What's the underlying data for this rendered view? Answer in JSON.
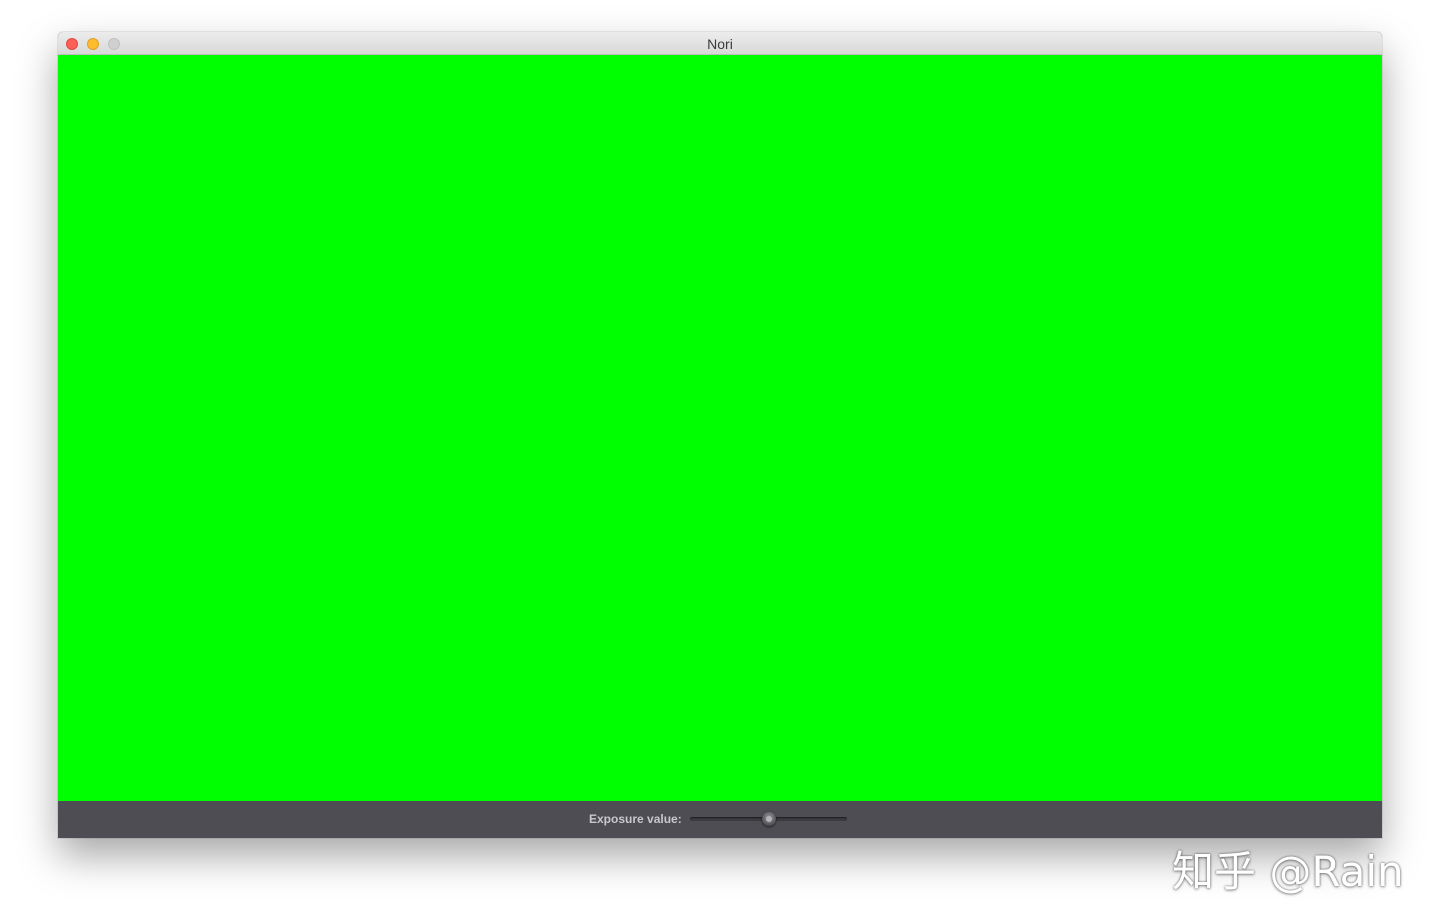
{
  "window": {
    "title": "Nori"
  },
  "canvas": {
    "background_color": "#00ff00"
  },
  "toolbar": {
    "exposure_label": "Exposure value:",
    "exposure_slider_fraction": 0.5
  },
  "watermark": {
    "text": "知乎 @Rain"
  },
  "colors": {
    "close": "#fc5f57",
    "minimize": "#fdbc2e",
    "maximize_disabled": "#d0d0d0",
    "bottom_bar": "#4d4d53"
  }
}
